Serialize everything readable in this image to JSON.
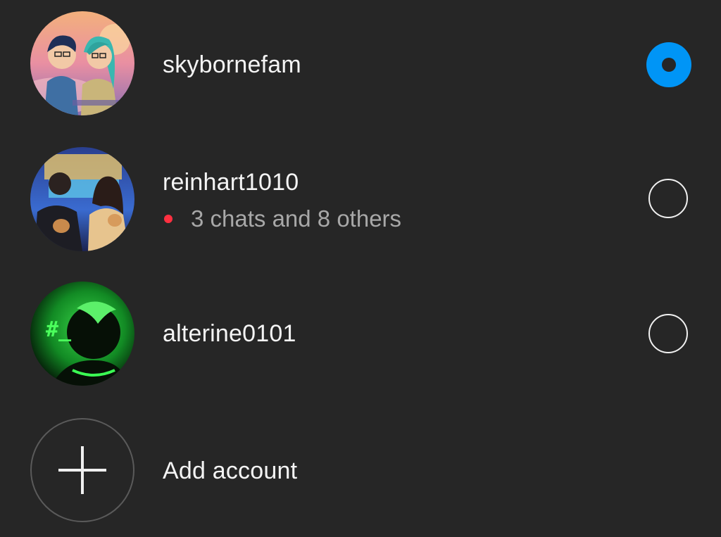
{
  "accounts": [
    {
      "username": "skybornefam",
      "selected": true,
      "notification": null,
      "avatar_icon": "couple-anime-avatar"
    },
    {
      "username": "reinhart1010",
      "selected": false,
      "notification": "3 chats and 8 others",
      "avatar_icon": "couple-photo-avatar"
    },
    {
      "username": "alterine0101",
      "selected": false,
      "notification": null,
      "avatar_icon": "green-hash-avatar"
    }
  ],
  "add_account": {
    "label": "Add account",
    "icon": "plus-icon"
  },
  "colors": {
    "background": "#262626",
    "selected_radio": "#0095f6",
    "notification_dot": "#ff3040",
    "secondary_text": "#a8a8a8"
  }
}
